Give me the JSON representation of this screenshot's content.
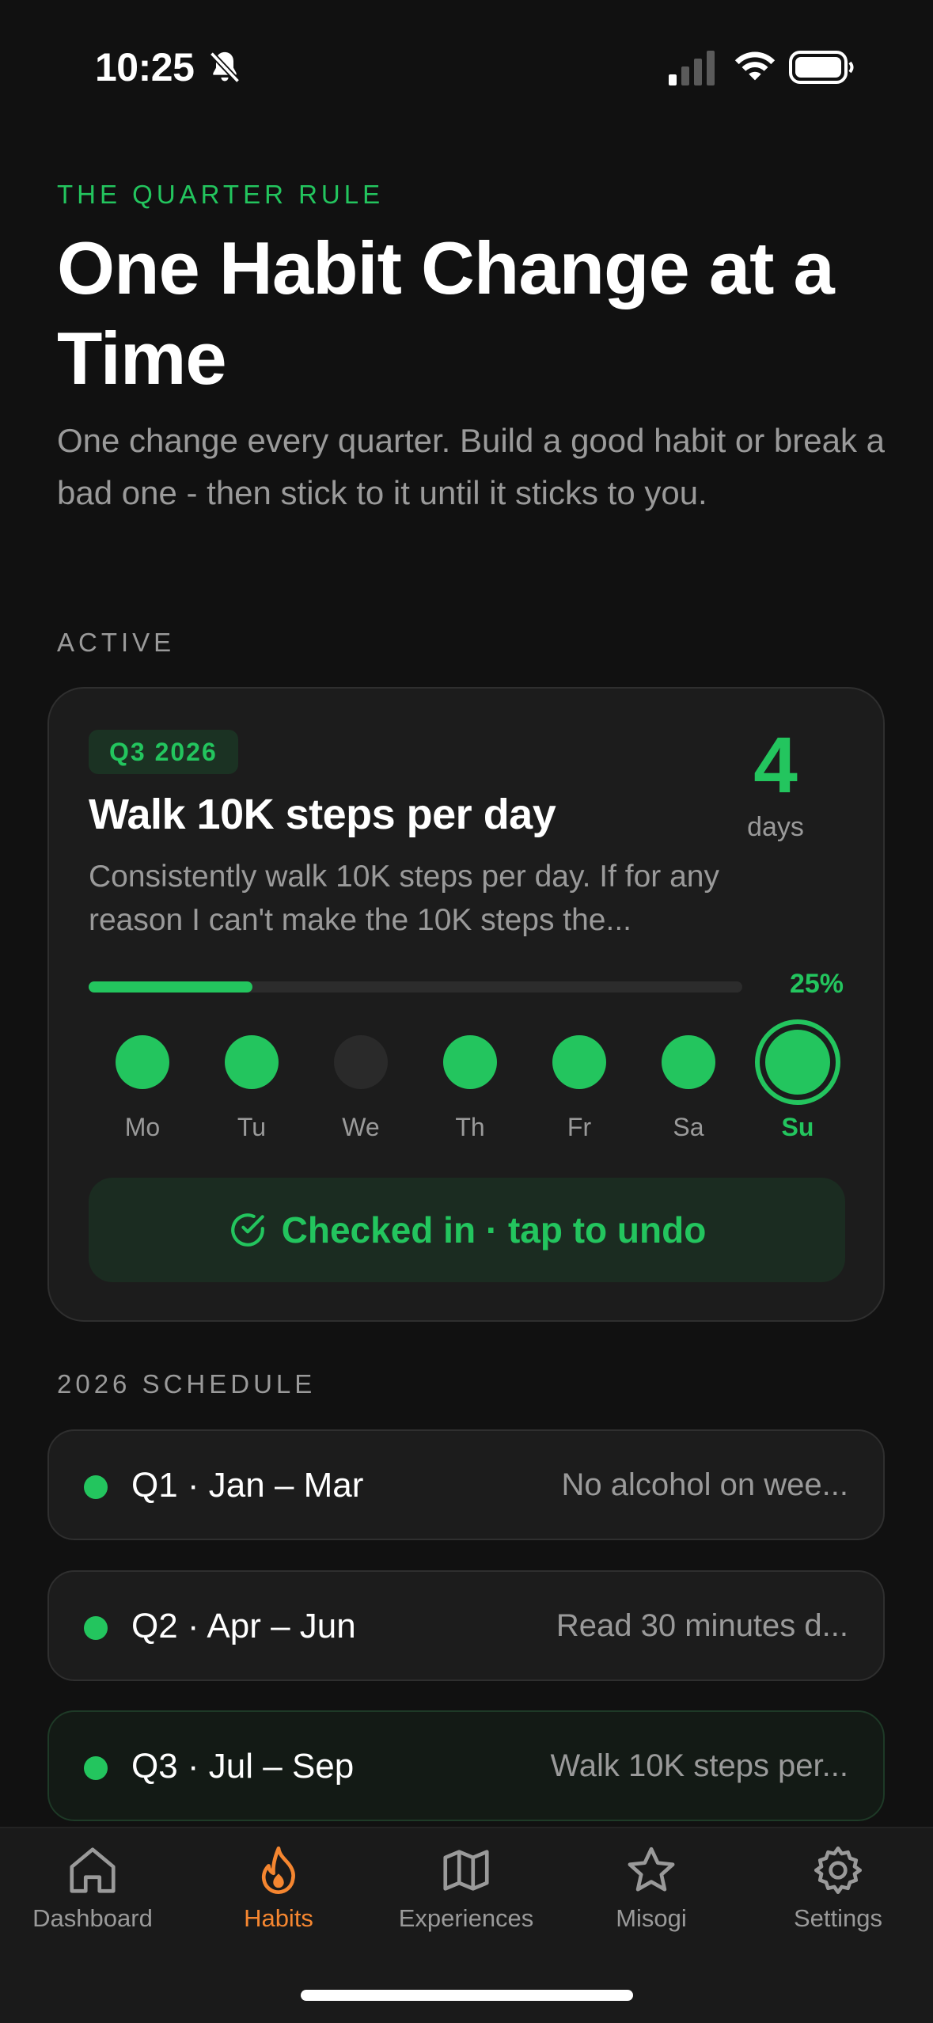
{
  "status_bar": {
    "time": "10:25",
    "icons": [
      "bell-slash-icon",
      "cellular-signal-icon",
      "wifi-icon",
      "battery-icon"
    ]
  },
  "header": {
    "eyebrow": "THE QUARTER RULE",
    "title": "One Habit Change at a Time",
    "subtitle": "One change every quarter. Build a good habit or break a bad one - then stick to it until it sticks to you."
  },
  "active_section": {
    "label": "ACTIVE",
    "card": {
      "badge": "Q3 2026",
      "title": "Walk 10K steps per day",
      "description": "Consistently walk 10K steps per day. If for any reason I can't make the 10K steps the...",
      "streak_value": "4",
      "streak_unit": "days",
      "progress_percent_label": "25%",
      "progress_fraction": 0.25,
      "week": [
        {
          "label": "Mo",
          "done": true,
          "today": false
        },
        {
          "label": "Tu",
          "done": true,
          "today": false
        },
        {
          "label": "We",
          "done": false,
          "today": false
        },
        {
          "label": "Th",
          "done": true,
          "today": false
        },
        {
          "label": "Fr",
          "done": true,
          "today": false
        },
        {
          "label": "Sa",
          "done": true,
          "today": false
        },
        {
          "label": "Su",
          "done": true,
          "today": true
        }
      ],
      "checkin_label": "Checked in · tap to undo"
    }
  },
  "schedule": {
    "label": "2026 SCHEDULE",
    "rows": [
      {
        "quarter": "Q1 · Jan – Mar",
        "habit": "No alcohol on wee...",
        "current": false
      },
      {
        "quarter": "Q2 · Apr – Jun",
        "habit": "Read 30 minutes d...",
        "current": false
      },
      {
        "quarter": "Q3 · Jul – Sep",
        "habit": "Walk 10K steps per...",
        "current": true
      }
    ]
  },
  "tab_bar": {
    "tabs": [
      {
        "label": "Dashboard",
        "icon": "home-icon",
        "active": false
      },
      {
        "label": "Habits",
        "icon": "flame-icon",
        "active": true
      },
      {
        "label": "Experiences",
        "icon": "map-icon",
        "active": false
      },
      {
        "label": "Misogi",
        "icon": "star-icon",
        "active": false
      },
      {
        "label": "Settings",
        "icon": "gear-icon",
        "active": false
      }
    ]
  },
  "colors": {
    "accent": "#23c55e",
    "tab_active": "#f58630",
    "background": "#111111",
    "card": "#1c1c1c",
    "muted_text": "#9a9a9a"
  }
}
